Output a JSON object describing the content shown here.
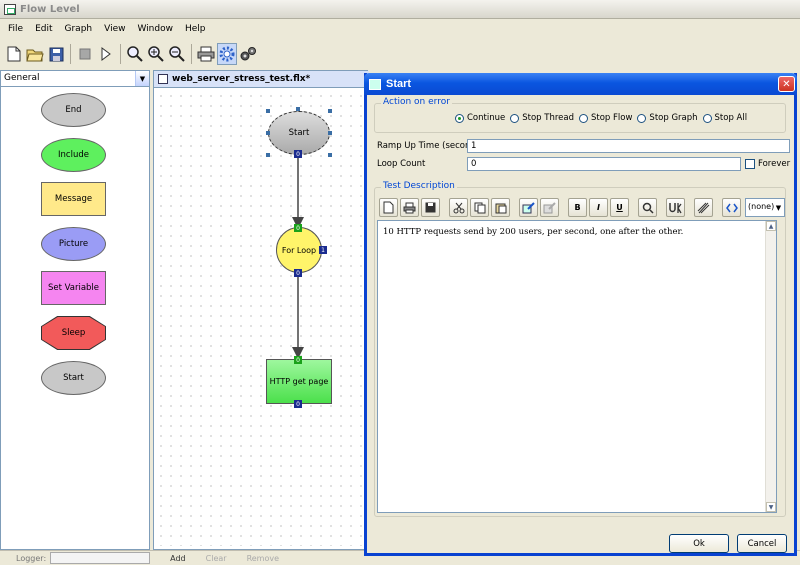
{
  "window": {
    "title": "Flow Level"
  },
  "menu": [
    "File",
    "Edit",
    "Graph",
    "View",
    "Window",
    "Help"
  ],
  "toolbar": [
    "new-icon",
    "open-icon",
    "save-icon",
    "stop-icon",
    "run-icon",
    "zoom-icon",
    "zoom-in-icon",
    "zoom-out-icon",
    "print-icon",
    "settings-icon",
    "plugins-icon"
  ],
  "palette": {
    "category": "General",
    "items": [
      {
        "label": "End",
        "shape": "ellipse",
        "color": "#c8c8c8"
      },
      {
        "label": "Include",
        "shape": "ellipse",
        "color": "#5ef05e"
      },
      {
        "label": "Message",
        "shape": "rect",
        "color": "#ffe98a"
      },
      {
        "label": "Picture",
        "shape": "ellipse",
        "color": "#9a9cf5"
      },
      {
        "label": "Set Variable",
        "shape": "rect",
        "color": "#f585f0"
      },
      {
        "label": "Sleep",
        "shape": "octagon",
        "color": "#f25a5a"
      },
      {
        "label": "Start",
        "shape": "ellipse",
        "color": "#c8c8c8"
      }
    ]
  },
  "editor": {
    "tab_label": "web_server_stress_test.flx*",
    "nodes": [
      {
        "label": "Start",
        "port_out": "0"
      },
      {
        "label": "For Loop",
        "port_in": "0",
        "port_side": "1",
        "port_out": "0"
      },
      {
        "label": "HTTP get page",
        "port_in": "0",
        "port_out": "0"
      }
    ]
  },
  "dialog": {
    "title": "Start",
    "action_group_label": "Action on error",
    "radios": [
      "Continue",
      "Stop Thread",
      "Stop Flow",
      "Stop Graph",
      "Stop All"
    ],
    "radio_selected": "Continue",
    "ramp_label": "Ramp Up Time (seconds)",
    "ramp_value": "1",
    "loop_label": "Loop Count",
    "loop_value": "0",
    "forever_label": "Forever",
    "desc_group_label": "Test Description",
    "style_combo": "(none)",
    "bold_label": "B",
    "italic_label": "I",
    "underline_label": "U",
    "description": "10 HTTP requests send by 200 users, per second, one after the other.",
    "ok_label": "Ok",
    "cancel_label": "Cancel"
  },
  "statusbar": {
    "logger_label": "Logger:",
    "add_label": "Add",
    "clear_label": "Clear",
    "remove_label": "Remove"
  }
}
